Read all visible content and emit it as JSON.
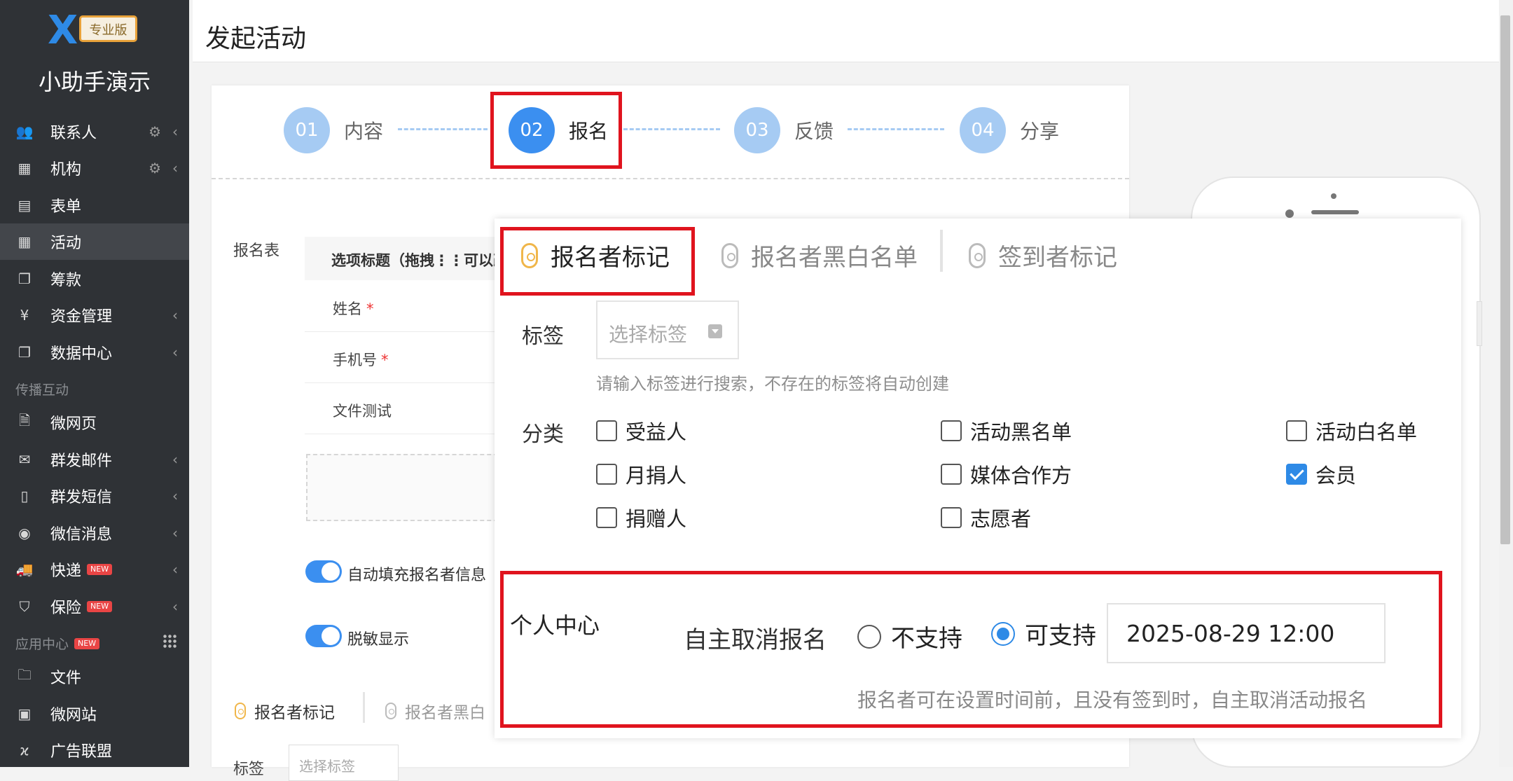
{
  "sidebar": {
    "logo_badge": "专业版",
    "brand": "小助手演示",
    "items": [
      {
        "label": "联系人"
      },
      {
        "label": "机构"
      },
      {
        "label": "表单"
      },
      {
        "label": "活动"
      },
      {
        "label": "筹款"
      },
      {
        "label": "资金管理"
      },
      {
        "label": "数据中心"
      },
      {
        "label": "微网页"
      },
      {
        "label": "群发邮件"
      },
      {
        "label": "群发短信"
      },
      {
        "label": "微信消息"
      },
      {
        "label": "快递"
      },
      {
        "label": "保险"
      },
      {
        "label": "文件"
      },
      {
        "label": "微网站"
      },
      {
        "label": "广告联盟"
      }
    ],
    "section_spread": "传播互动",
    "section_apps": "应用中心",
    "new_badge": "NEW"
  },
  "header": {
    "title": "发起活动"
  },
  "steps": [
    {
      "num": "01",
      "label": "内容"
    },
    {
      "num": "02",
      "label": "报名"
    },
    {
      "num": "03",
      "label": "反馈"
    },
    {
      "num": "04",
      "label": "分享"
    }
  ],
  "form": {
    "section_label": "报名表",
    "table_header": "选项标题（拖拽⋮⋮可以改",
    "rows": [
      {
        "label": "姓名",
        "required": "*"
      },
      {
        "label": "手机号",
        "required": "*"
      },
      {
        "label": "文件测试",
        "required": ""
      }
    ],
    "toggles": [
      {
        "label": "自动填充报名者信息"
      },
      {
        "label": "脱敏显示"
      }
    ],
    "bottom_tabs": [
      {
        "label": "报名者标记"
      },
      {
        "label": "报名者黑白"
      }
    ],
    "tag_label": "标签",
    "tag_placeholder": "选择标签"
  },
  "panel": {
    "tabs": [
      {
        "label": "报名者标记"
      },
      {
        "label": "报名者黑白名单"
      },
      {
        "label": "签到者标记"
      }
    ],
    "tag_label": "标签",
    "tag_placeholder": "选择标签",
    "tag_help": "请输入标签进行搜索，不存在的标签将自动创建",
    "category_label": "分类",
    "categories": [
      {
        "label": "受益人",
        "checked": false
      },
      {
        "label": "活动黑名单",
        "checked": false
      },
      {
        "label": "活动白名单",
        "checked": false
      },
      {
        "label": "月捐人",
        "checked": false
      },
      {
        "label": "媒体合作方",
        "checked": false
      },
      {
        "label": "会员",
        "checked": true
      },
      {
        "label": "捐赠人",
        "checked": false
      },
      {
        "label": "志愿者",
        "checked": false
      }
    ],
    "personal_center": {
      "title": "个人中心",
      "cancel_label": "自主取消报名",
      "options": [
        {
          "label": "不支持",
          "selected": false
        },
        {
          "label": "可支持",
          "selected": true
        }
      ],
      "deadline": "2025-08-29 12:00",
      "help": "报名者可在设置时间前，且没有签到时，自主取消活动报名"
    }
  },
  "colors": {
    "sidebar_bg": "#2f3236",
    "accent": "#3b8ff0",
    "highlight": "#e0141e",
    "tab_active": "#f0b64a"
  }
}
